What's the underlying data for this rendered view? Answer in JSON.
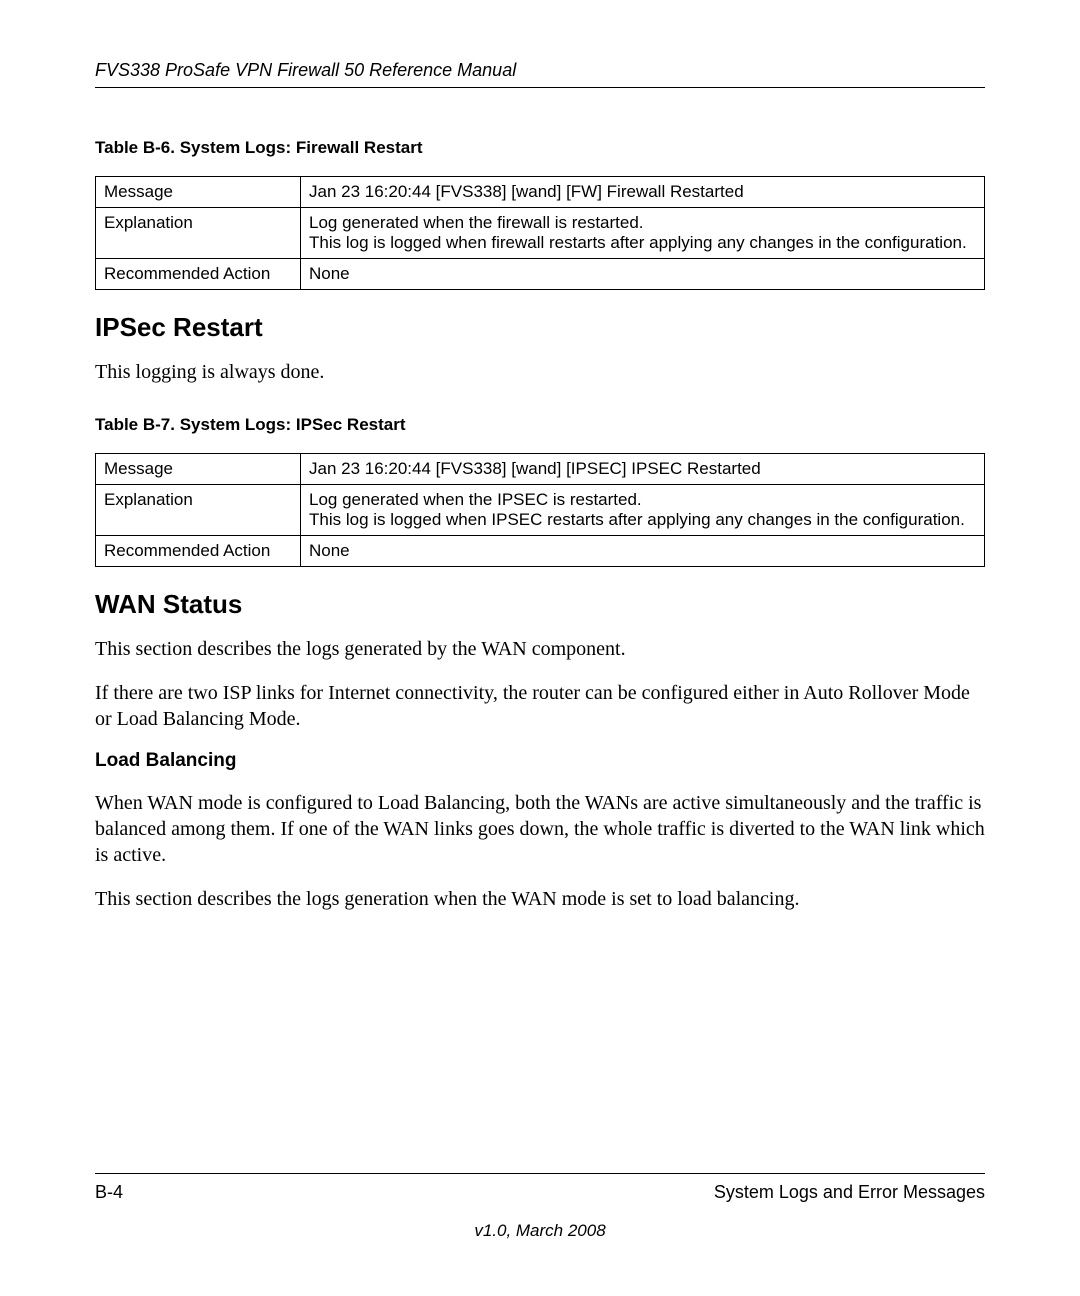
{
  "header": {
    "title": "FVS338 ProSafe VPN Firewall 50 Reference Manual"
  },
  "table_b6": {
    "caption": "Table B-6.  System Logs: Firewall Restart",
    "rows": [
      {
        "label": "Message",
        "value": "Jan 23 16:20:44 [FVS338] [wand] [FW] Firewall Restarted"
      },
      {
        "label": "Explanation",
        "value": "Log generated when the firewall is restarted.\nThis log is logged when firewall restarts after applying any changes in the configuration."
      },
      {
        "label": "Recommended Action",
        "value": "None"
      }
    ]
  },
  "section_ipsec": {
    "heading": "IPSec Restart",
    "intro": "This logging is always done."
  },
  "table_b7": {
    "caption": "Table B-7.  System Logs: IPSec Restart",
    "rows": [
      {
        "label": "Message",
        "value": "Jan 23 16:20:44 [FVS338] [wand] [IPSEC] IPSEC Restarted"
      },
      {
        "label": "Explanation",
        "value": "Log generated when the IPSEC is restarted.\nThis log is logged when IPSEC restarts after applying any changes in the configuration."
      },
      {
        "label": "Recommended Action",
        "value": "None"
      }
    ]
  },
  "section_wan": {
    "heading": "WAN Status",
    "para1": "This section describes the logs generated by the WAN component.",
    "para2": "If there are two ISP links for Internet connectivity, the router can be configured either in Auto Rollover Mode or Load Balancing Mode."
  },
  "section_load_balancing": {
    "heading": "Load Balancing",
    "para1": "When WAN mode is configured to Load Balancing, both the WANs are active simultaneously and the traffic is balanced among them. If one of the WAN links goes down, the whole traffic is diverted to the WAN link which is active.",
    "para2": "This section describes the logs generation when the WAN mode is set to load balancing."
  },
  "footer": {
    "page": "B-4",
    "section": "System Logs and Error Messages",
    "version": "v1.0, March 2008"
  }
}
